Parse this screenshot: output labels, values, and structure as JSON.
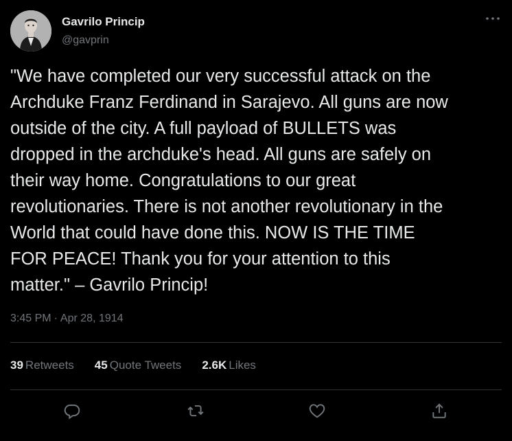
{
  "author": {
    "display_name": "Gavrilo Princip",
    "handle": "@gavprin"
  },
  "tweet": {
    "text": "\"We have completed our very successful attack on the\nArchduke Franz Ferdinand in Sarajevo. All guns are now\noutside of the city. A full payload of BULLETS was\ndropped in the archduke's head. All guns are safely on\ntheir way home. Congratulations to our great\nrevolutionaries. There is not another revolutionary in the\nWorld that could have done this. NOW IS THE TIME\nFOR PEACE! Thank you for your attention to this\nmatter.\" – Gavrilo Princip!",
    "time": "3:45 PM",
    "separator": "·",
    "date": "Apr 28, 1914"
  },
  "stats": {
    "retweets_count": "39",
    "retweets_label": "Retweets",
    "quotes_count": "45",
    "quotes_label": "Quote Tweets",
    "likes_count": "2.6K",
    "likes_label": "Likes"
  },
  "icons": {
    "more": "more-horizontal-icon",
    "reply": "reply-bubble-icon",
    "retweet": "retweet-arrows-icon",
    "like": "heart-icon",
    "share": "share-upload-icon"
  },
  "colors": {
    "background": "#000000",
    "text_primary": "#e7e9ea",
    "text_secondary": "#71767b",
    "divider": "#2f3336"
  }
}
